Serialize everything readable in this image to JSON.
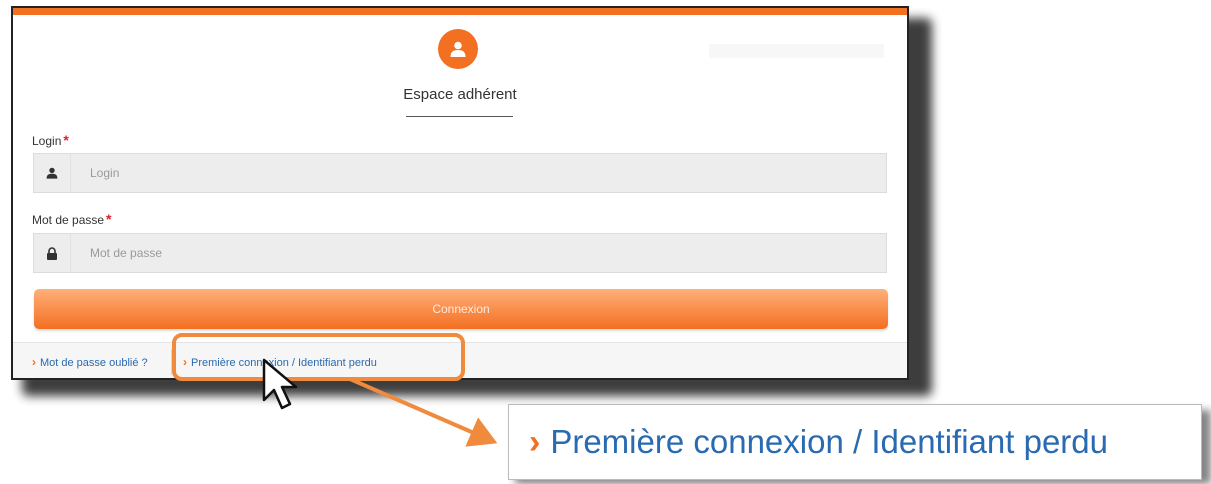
{
  "colors": {
    "accent": "#f36f21",
    "accent_light": "#ffb07a",
    "link": "#2a6ab0",
    "required": "#d9232e",
    "callout": "#f08a3c"
  },
  "header": {
    "title": "Espace adhérent",
    "icon": "user-icon"
  },
  "form": {
    "login": {
      "label": "Login",
      "required_mark": "*",
      "placeholder": "Login",
      "icon": "user-icon"
    },
    "password": {
      "label": "Mot de passe",
      "required_mark": "*",
      "placeholder": "Mot de passe",
      "icon": "lock-icon"
    },
    "submit_label": "Connexion"
  },
  "footer": {
    "chevron": "›",
    "forgot_password": "Mot de passe oublié ?",
    "first_login": "Première connexion / Identifiant perdu"
  },
  "callout": {
    "chevron": "›",
    "text": "Première connexion / Identifiant perdu"
  }
}
